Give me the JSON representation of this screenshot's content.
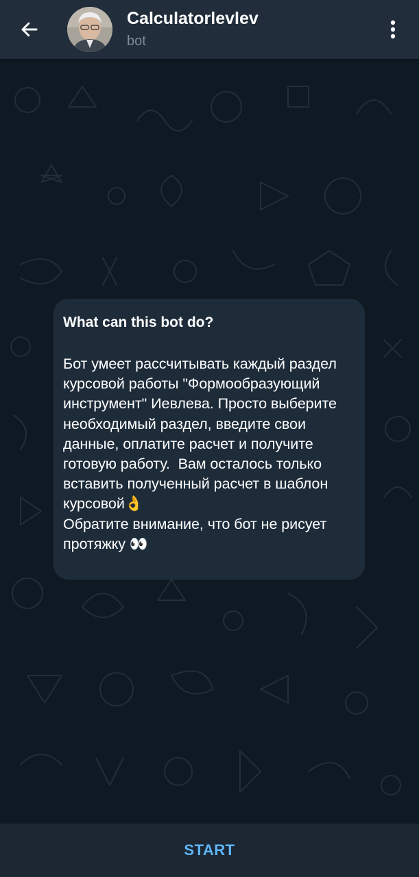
{
  "header": {
    "title": "Calculatorlevlev",
    "subtitle": "bot",
    "back_icon": "arrow-left-icon",
    "menu_icon": "more-vertical-icon"
  },
  "bubble": {
    "title": "What can this bot do?",
    "text": "Бот умеет рассчитывать каждый раздел курсовой работы \"Формообразующий инструмент\" Иевлева. Просто выберите необходимый раздел, введите свои данные, оплатите расчет и получите готовую работу.  Вам осталось только вставить полученный расчет в шаблон курсовой👌\nОбратите внимание, что бот не рисует протяжку 👀"
  },
  "footer": {
    "start_label": "START"
  },
  "colors": {
    "header_bg": "#212d3b",
    "chat_bg": "#0f1923",
    "bubble_bg": "#1e2c3a",
    "accent": "#5eb5f7"
  }
}
